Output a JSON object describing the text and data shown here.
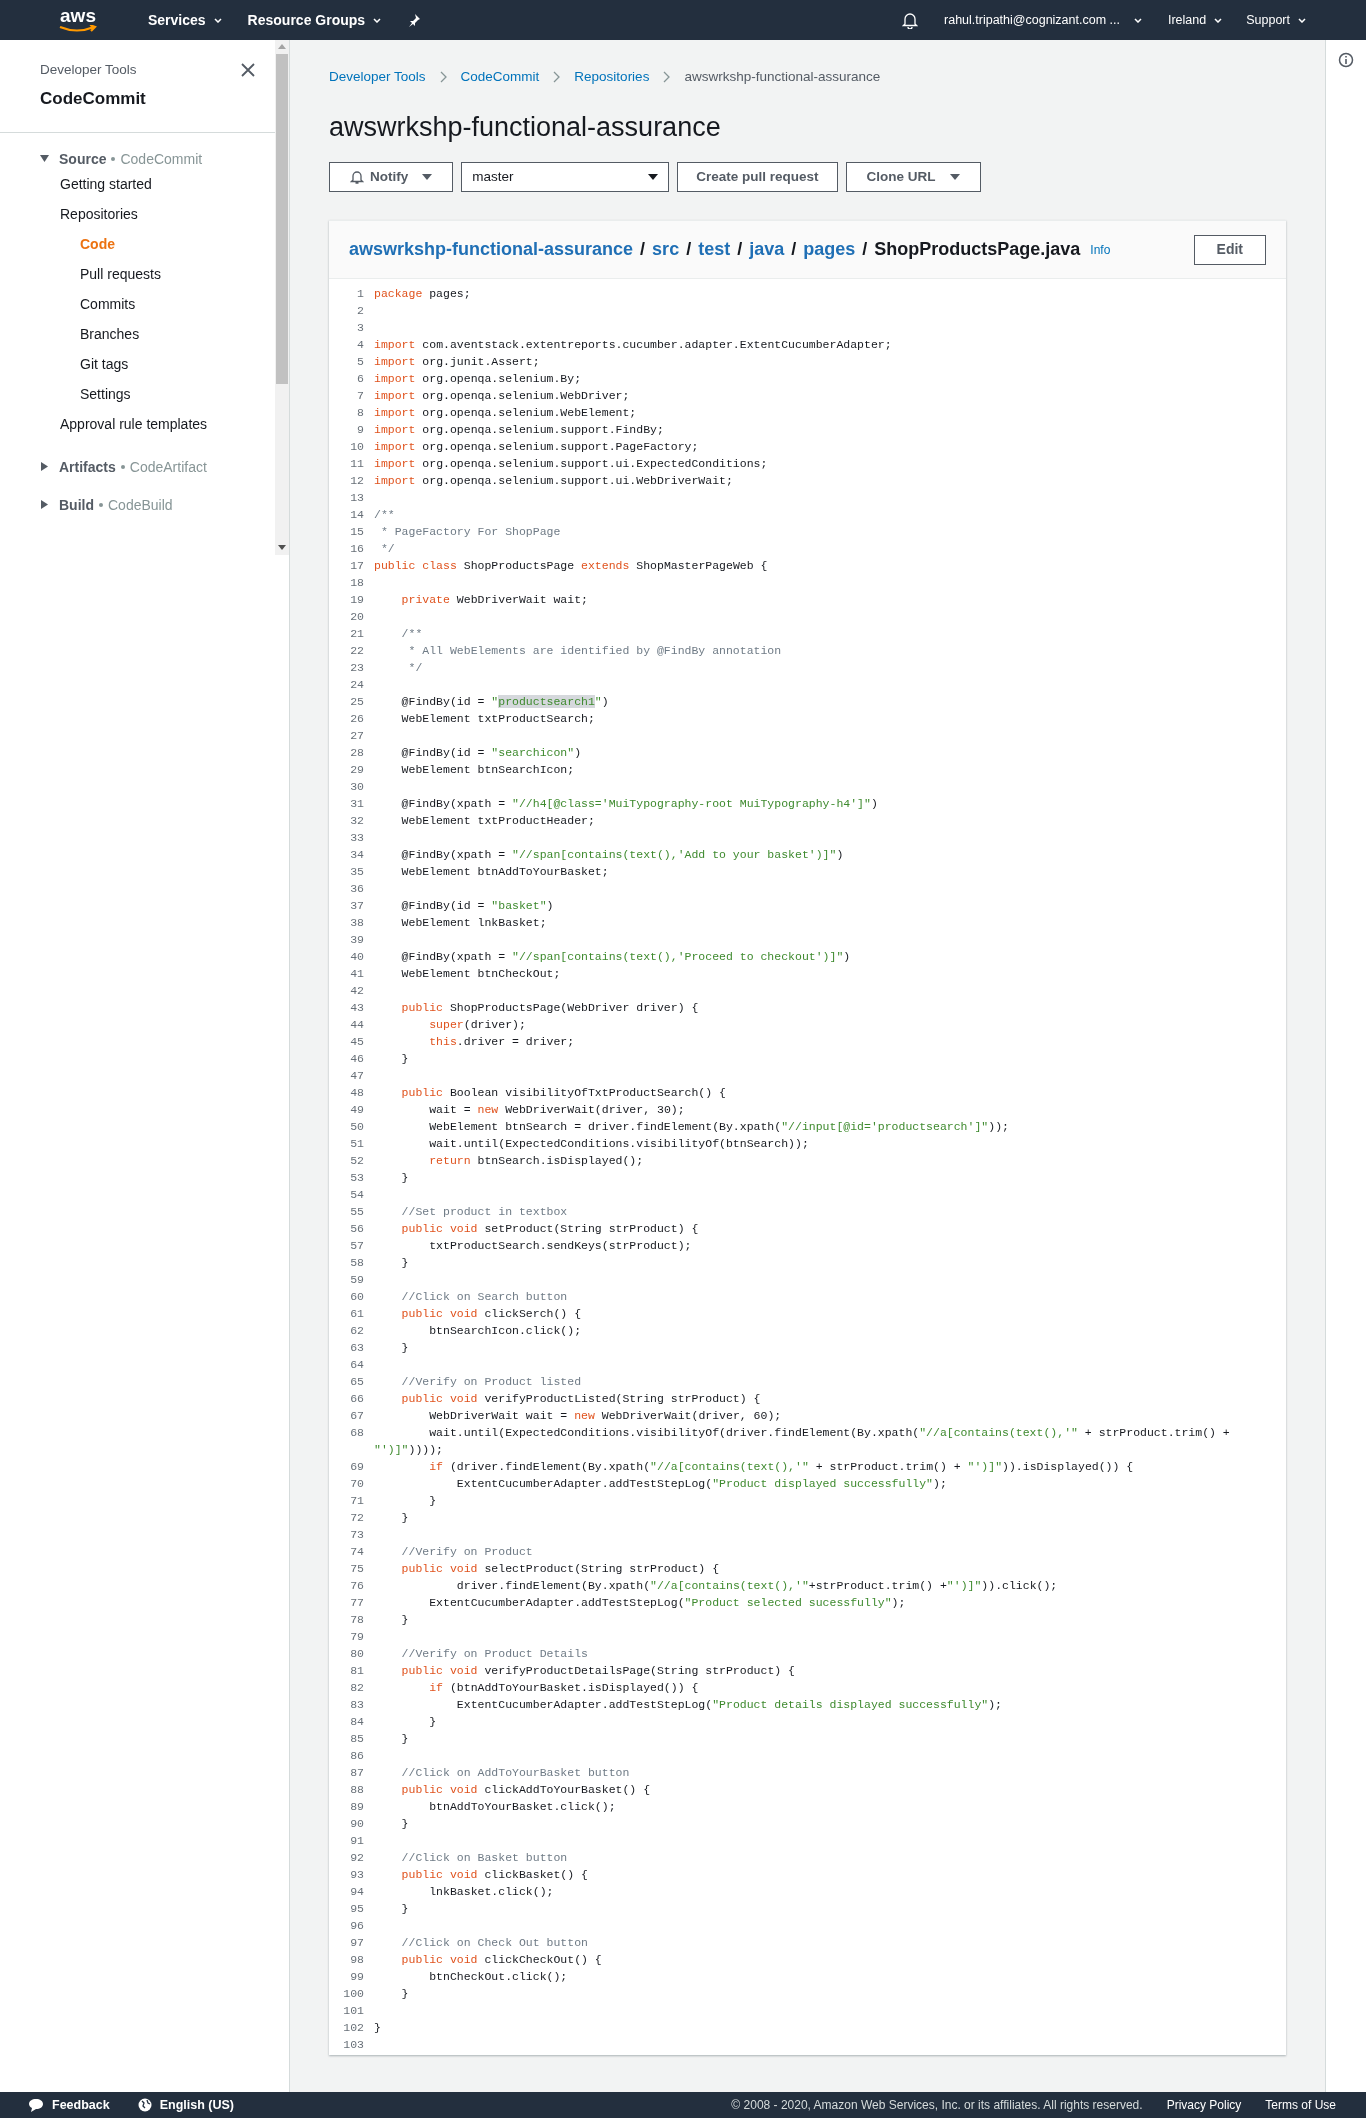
{
  "topnav": {
    "logo": "aws",
    "menus": [
      {
        "label": "Services"
      },
      {
        "label": "Resource Groups"
      }
    ],
    "account": "rahul.tripathi@cognizant.com ...",
    "region": "Ireland",
    "support": "Support"
  },
  "sidebar": {
    "subtitle": "Developer Tools",
    "title": "CodeCommit",
    "sections": [
      {
        "label": "Source",
        "service": "CodeCommit",
        "expanded": true,
        "children": [
          {
            "label": "Getting started",
            "selected": false
          },
          {
            "label": "Repositories",
            "selected": false,
            "children": [
              {
                "label": "Code",
                "selected": true
              },
              {
                "label": "Pull requests",
                "selected": false
              },
              {
                "label": "Commits",
                "selected": false
              },
              {
                "label": "Branches",
                "selected": false
              },
              {
                "label": "Git tags",
                "selected": false
              },
              {
                "label": "Settings",
                "selected": false
              }
            ]
          },
          {
            "label": "Approval rule templates",
            "selected": false
          }
        ]
      },
      {
        "label": "Artifacts",
        "service": "CodeArtifact",
        "expanded": false
      },
      {
        "label": "Build",
        "service": "CodeBuild",
        "expanded": false
      }
    ]
  },
  "breadcrumbs": [
    "Developer Tools",
    "CodeCommit",
    "Repositories",
    "awswrkshp-functional-assurance"
  ],
  "title": "awswrkshp-functional-assurance",
  "toolbar": {
    "notify": "Notify",
    "branch": "master",
    "create_pr": "Create pull request",
    "clone_url": "Clone URL"
  },
  "file": {
    "path": [
      "awswrkshp-functional-assurance",
      "src",
      "test",
      "java",
      "pages"
    ],
    "separator": "/",
    "name": "ShopProductsPage.java",
    "info": "Info",
    "edit": "Edit"
  },
  "code": [
    {
      "n": "1",
      "s": [
        {
          "kind": "keyword",
          "text": "package"
        },
        {
          "kind": "plain",
          "text": " pages;"
        }
      ]
    },
    {
      "n": "2"
    },
    {
      "n": "3"
    },
    {
      "n": "4",
      "s": [
        {
          "kind": "keyword",
          "text": "import"
        },
        {
          "kind": "plain",
          "text": " com.aventstack.extentreports.cucumber.adapter.ExtentCucumberAdapter;"
        }
      ]
    },
    {
      "n": "5",
      "s": [
        {
          "kind": "keyword",
          "text": "import"
        },
        {
          "kind": "plain",
          "text": " org.junit.Assert;"
        }
      ]
    },
    {
      "n": "6",
      "s": [
        {
          "kind": "keyword",
          "text": "import"
        },
        {
          "kind": "plain",
          "text": " org.openqa.selenium.By;"
        }
      ]
    },
    {
      "n": "7",
      "s": [
        {
          "kind": "keyword",
          "text": "import"
        },
        {
          "kind": "plain",
          "text": " org.openqa.selenium.WebDriver;"
        }
      ]
    },
    {
      "n": "8",
      "s": [
        {
          "kind": "keyword",
          "text": "import"
        },
        {
          "kind": "plain",
          "text": " org.openqa.selenium.WebElement;"
        }
      ]
    },
    {
      "n": "9",
      "s": [
        {
          "kind": "keyword",
          "text": "import"
        },
        {
          "kind": "plain",
          "text": " org.openqa.selenium.support.FindBy;"
        }
      ]
    },
    {
      "n": "10",
      "s": [
        {
          "kind": "keyword",
          "text": "import"
        },
        {
          "kind": "plain",
          "text": " org.openqa.selenium.support.PageFactory;"
        }
      ]
    },
    {
      "n": "11",
      "s": [
        {
          "kind": "keyword",
          "text": "import"
        },
        {
          "kind": "plain",
          "text": " org.openqa.selenium.support.ui.ExpectedConditions;"
        }
      ]
    },
    {
      "n": "12",
      "s": [
        {
          "kind": "keyword",
          "text": "import"
        },
        {
          "kind": "plain",
          "text": " org.openqa.selenium.support.ui.WebDriverWait;"
        }
      ]
    },
    {
      "n": "13"
    },
    {
      "n": "14",
      "s": [
        {
          "kind": "comment",
          "text": "/**"
        }
      ]
    },
    {
      "n": "15",
      "s": [
        {
          "kind": "comment",
          "text": " * PageFactory For ShopPage"
        }
      ]
    },
    {
      "n": "16",
      "s": [
        {
          "kind": "comment",
          "text": " */"
        }
      ]
    },
    {
      "n": "17",
      "s": [
        {
          "kind": "keyword",
          "text": "public class"
        },
        {
          "kind": "plain",
          "text": " ShopProductsPage "
        },
        {
          "kind": "keyword",
          "text": "extends"
        },
        {
          "kind": "plain",
          "text": " ShopMasterPageWeb {"
        }
      ]
    },
    {
      "n": "18"
    },
    {
      "n": "19",
      "s": [
        {
          "kind": "keyword",
          "text": "    private"
        },
        {
          "kind": "plain",
          "text": " WebDriverWait wait;"
        }
      ]
    },
    {
      "n": "20"
    },
    {
      "n": "21",
      "s": [
        {
          "kind": "comment",
          "text": "    /**"
        }
      ]
    },
    {
      "n": "22",
      "s": [
        {
          "kind": "comment",
          "text": "     * All WebElements are identified by @FindBy annotation"
        }
      ]
    },
    {
      "n": "23",
      "s": [
        {
          "kind": "comment",
          "text": "     */"
        }
      ]
    },
    {
      "n": "24"
    },
    {
      "n": "25",
      "s": [
        {
          "kind": "plain",
          "text": "    @FindBy(id = "
        },
        {
          "kind": "string",
          "text": "\""
        },
        {
          "kind": "highlight",
          "text": "productsearch1"
        },
        {
          "kind": "string",
          "text": "\""
        },
        {
          "kind": "plain",
          "text": ")"
        }
      ]
    },
    {
      "n": "26",
      "s": [
        {
          "kind": "plain",
          "text": "    WebElement txtProductSearch;"
        }
      ]
    },
    {
      "n": "27"
    },
    {
      "n": "28",
      "s": [
        {
          "kind": "plain",
          "text": "    @FindBy(id = "
        },
        {
          "kind": "string",
          "text": "\"searchicon\""
        },
        {
          "kind": "plain",
          "text": ")"
        }
      ]
    },
    {
      "n": "29",
      "s": [
        {
          "kind": "plain",
          "text": "    WebElement btnSearchIcon;"
        }
      ]
    },
    {
      "n": "30"
    },
    {
      "n": "31",
      "s": [
        {
          "kind": "plain",
          "text": "    @FindBy(xpath = "
        },
        {
          "kind": "string",
          "text": "\"//h4[@class='MuiTypography-root MuiTypography-h4']\""
        },
        {
          "kind": "plain",
          "text": ")"
        }
      ]
    },
    {
      "n": "32",
      "s": [
        {
          "kind": "plain",
          "text": "    WebElement txtProductHeader;"
        }
      ]
    },
    {
      "n": "33"
    },
    {
      "n": "34",
      "s": [
        {
          "kind": "plain",
          "text": "    @FindBy(xpath = "
        },
        {
          "kind": "string",
          "text": "\"//span[contains(text(),'Add to your basket')]\""
        },
        {
          "kind": "plain",
          "text": ")"
        }
      ]
    },
    {
      "n": "35",
      "s": [
        {
          "kind": "plain",
          "text": "    WebElement btnAddToYourBasket;"
        }
      ]
    },
    {
      "n": "36"
    },
    {
      "n": "37",
      "s": [
        {
          "kind": "plain",
          "text": "    @FindBy(id = "
        },
        {
          "kind": "string",
          "text": "\"basket\""
        },
        {
          "kind": "plain",
          "text": ")"
        }
      ]
    },
    {
      "n": "38",
      "s": [
        {
          "kind": "plain",
          "text": "    WebElement lnkBasket;"
        }
      ]
    },
    {
      "n": "39"
    },
    {
      "n": "40",
      "s": [
        {
          "kind": "plain",
          "text": "    @FindBy(xpath = "
        },
        {
          "kind": "string",
          "text": "\"//span[contains(text(),'Proceed to checkout')]\""
        },
        {
          "kind": "plain",
          "text": ")"
        }
      ]
    },
    {
      "n": "41",
      "s": [
        {
          "kind": "plain",
          "text": "    WebElement btnCheckOut;"
        }
      ]
    },
    {
      "n": "42"
    },
    {
      "n": "43",
      "s": [
        {
          "kind": "keyword",
          "text": "    public"
        },
        {
          "kind": "plain",
          "text": " ShopProductsPage(WebDriver driver) {"
        }
      ]
    },
    {
      "n": "44",
      "s": [
        {
          "kind": "keyword",
          "text": "        super"
        },
        {
          "kind": "plain",
          "text": "(driver);"
        }
      ]
    },
    {
      "n": "45",
      "s": [
        {
          "kind": "keyword",
          "text": "        this"
        },
        {
          "kind": "plain",
          "text": ".driver = driver;"
        }
      ]
    },
    {
      "n": "46",
      "s": [
        {
          "kind": "plain",
          "text": "    }"
        }
      ]
    },
    {
      "n": "47"
    },
    {
      "n": "48",
      "s": [
        {
          "kind": "keyword",
          "text": "    public"
        },
        {
          "kind": "plain",
          "text": " Boolean visibilityOfTxtProductSearch() {"
        }
      ]
    },
    {
      "n": "49",
      "s": [
        {
          "kind": "plain",
          "text": "        wait = "
        },
        {
          "kind": "keyword",
          "text": "new"
        },
        {
          "kind": "plain",
          "text": " WebDriverWait(driver, 30);"
        }
      ]
    },
    {
      "n": "50",
      "s": [
        {
          "kind": "plain",
          "text": "        WebElement btnSearch = driver.findElement(By.xpath("
        },
        {
          "kind": "string",
          "text": "\"//input[@id='productsearch']\""
        },
        {
          "kind": "plain",
          "text": "));"
        }
      ]
    },
    {
      "n": "51",
      "s": [
        {
          "kind": "plain",
          "text": "        wait.until(ExpectedConditions.visibilityOf(btnSearch));"
        }
      ]
    },
    {
      "n": "52",
      "s": [
        {
          "kind": "keyword",
          "text": "        return"
        },
        {
          "kind": "plain",
          "text": " btnSearch.isDisplayed();"
        }
      ]
    },
    {
      "n": "53",
      "s": [
        {
          "kind": "plain",
          "text": "    }"
        }
      ]
    },
    {
      "n": "54"
    },
    {
      "n": "55",
      "s": [
        {
          "kind": "comment",
          "text": "    //Set product in textbox"
        }
      ]
    },
    {
      "n": "56",
      "s": [
        {
          "kind": "keyword",
          "text": "    public void"
        },
        {
          "kind": "plain",
          "text": " setProduct(String strProduct) {"
        }
      ]
    },
    {
      "n": "57",
      "s": [
        {
          "kind": "plain",
          "text": "        txtProductSearch.sendKeys(strProduct);"
        }
      ]
    },
    {
      "n": "58",
      "s": [
        {
          "kind": "plain",
          "text": "    }"
        }
      ]
    },
    {
      "n": "59"
    },
    {
      "n": "60",
      "s": [
        {
          "kind": "comment",
          "text": "    //Click on Search button"
        }
      ]
    },
    {
      "n": "61",
      "s": [
        {
          "kind": "keyword",
          "text": "    public void"
        },
        {
          "kind": "plain",
          "text": " clickSerch() {"
        }
      ]
    },
    {
      "n": "62",
      "s": [
        {
          "kind": "plain",
          "text": "        btnSearchIcon.click();"
        }
      ]
    },
    {
      "n": "63",
      "s": [
        {
          "kind": "plain",
          "text": "    }"
        }
      ]
    },
    {
      "n": "64"
    },
    {
      "n": "65",
      "s": [
        {
          "kind": "comment",
          "text": "    //Verify on Product listed"
        }
      ]
    },
    {
      "n": "66",
      "s": [
        {
          "kind": "keyword",
          "text": "    public void"
        },
        {
          "kind": "plain",
          "text": " verifyProductListed(String strProduct) {"
        }
      ]
    },
    {
      "n": "67",
      "s": [
        {
          "kind": "plain",
          "text": "        WebDriverWait wait = "
        },
        {
          "kind": "keyword",
          "text": "new"
        },
        {
          "kind": "plain",
          "text": " WebDriverWait(driver, 60);"
        }
      ]
    },
    {
      "n": "68",
      "s": [
        {
          "kind": "plain",
          "text": "        wait.until(ExpectedConditions.visibilityOf(driver.findElement(By.xpath("
        },
        {
          "kind": "string",
          "text": "\"//a[contains(text(),'\""
        },
        {
          "kind": "plain",
          "text": " + strProduct.trim() + "
        },
        {
          "kind": "string",
          "text": "\"')]\""
        },
        {
          "kind": "plain",
          "text": "))));"
        }
      ]
    },
    {
      "n": "69",
      "s": [
        {
          "kind": "keyword",
          "text": "        if"
        },
        {
          "kind": "plain",
          "text": " (driver.findElement(By.xpath("
        },
        {
          "kind": "string",
          "text": "\"//a[contains(text(),'\""
        },
        {
          "kind": "plain",
          "text": " + strProduct.trim() + "
        },
        {
          "kind": "string",
          "text": "\"')]\""
        },
        {
          "kind": "plain",
          "text": ")).isDisplayed()) {"
        }
      ]
    },
    {
      "n": "70",
      "s": [
        {
          "kind": "plain",
          "text": "            ExtentCucumberAdapter.addTestStepLog("
        },
        {
          "kind": "string",
          "text": "\"Product displayed successfully\""
        },
        {
          "kind": "plain",
          "text": ");"
        }
      ]
    },
    {
      "n": "71",
      "s": [
        {
          "kind": "plain",
          "text": "        }"
        }
      ]
    },
    {
      "n": "72",
      "s": [
        {
          "kind": "plain",
          "text": "    }"
        }
      ]
    },
    {
      "n": "73"
    },
    {
      "n": "74",
      "s": [
        {
          "kind": "comment",
          "text": "    //Verify on Product"
        }
      ]
    },
    {
      "n": "75",
      "s": [
        {
          "kind": "keyword",
          "text": "    public void"
        },
        {
          "kind": "plain",
          "text": " selectProduct(String strProduct) {"
        }
      ]
    },
    {
      "n": "76",
      "s": [
        {
          "kind": "plain",
          "text": "            driver.findElement(By.xpath("
        },
        {
          "kind": "string",
          "text": "\"//a[contains(text(),'\""
        },
        {
          "kind": "plain",
          "text": "+strProduct.trim() +"
        },
        {
          "kind": "string",
          "text": "\"')]\""
        },
        {
          "kind": "plain",
          "text": ")).click();"
        }
      ]
    },
    {
      "n": "77",
      "s": [
        {
          "kind": "plain",
          "text": "        ExtentCucumberAdapter.addTestStepLog("
        },
        {
          "kind": "string",
          "text": "\"Product selected sucessfully\""
        },
        {
          "kind": "plain",
          "text": ");"
        }
      ]
    },
    {
      "n": "78",
      "s": [
        {
          "kind": "plain",
          "text": "    }"
        }
      ]
    },
    {
      "n": "79"
    },
    {
      "n": "80",
      "s": [
        {
          "kind": "comment",
          "text": "    //Verify on Product Details"
        }
      ]
    },
    {
      "n": "81",
      "s": [
        {
          "kind": "keyword",
          "text": "    public void"
        },
        {
          "kind": "plain",
          "text": " verifyProductDetailsPage(String strProduct) {"
        }
      ]
    },
    {
      "n": "82",
      "s": [
        {
          "kind": "keyword",
          "text": "        if"
        },
        {
          "kind": "plain",
          "text": " (btnAddToYourBasket.isDisplayed()) {"
        }
      ]
    },
    {
      "n": "83",
      "s": [
        {
          "kind": "plain",
          "text": "            ExtentCucumberAdapter.addTestStepLog("
        },
        {
          "kind": "string",
          "text": "\"Product details displayed successfully\""
        },
        {
          "kind": "plain",
          "text": ");"
        }
      ]
    },
    {
      "n": "84",
      "s": [
        {
          "kind": "plain",
          "text": "        }"
        }
      ]
    },
    {
      "n": "85",
      "s": [
        {
          "kind": "plain",
          "text": "    }"
        }
      ]
    },
    {
      "n": "86"
    },
    {
      "n": "87",
      "s": [
        {
          "kind": "comment",
          "text": "    //Click on AddToYourBasket button"
        }
      ]
    },
    {
      "n": "88",
      "s": [
        {
          "kind": "keyword",
          "text": "    public void"
        },
        {
          "kind": "plain",
          "text": " clickAddToYourBasket() {"
        }
      ]
    },
    {
      "n": "89",
      "s": [
        {
          "kind": "plain",
          "text": "        btnAddToYourBasket.click();"
        }
      ]
    },
    {
      "n": "90",
      "s": [
        {
          "kind": "plain",
          "text": "    }"
        }
      ]
    },
    {
      "n": "91"
    },
    {
      "n": "92",
      "s": [
        {
          "kind": "comment",
          "text": "    //Click on Basket button"
        }
      ]
    },
    {
      "n": "93",
      "s": [
        {
          "kind": "keyword",
          "text": "    public void"
        },
        {
          "kind": "plain",
          "text": " clickBasket() {"
        }
      ]
    },
    {
      "n": "94",
      "s": [
        {
          "kind": "plain",
          "text": "        lnkBasket.click();"
        }
      ]
    },
    {
      "n": "95",
      "s": [
        {
          "kind": "plain",
          "text": "    }"
        }
      ]
    },
    {
      "n": "96"
    },
    {
      "n": "97",
      "s": [
        {
          "kind": "comment",
          "text": "    //Click on Check Out button"
        }
      ]
    },
    {
      "n": "98",
      "s": [
        {
          "kind": "keyword",
          "text": "    public void"
        },
        {
          "kind": "plain",
          "text": " clickCheckOut() {"
        }
      ]
    },
    {
      "n": "99",
      "s": [
        {
          "kind": "plain",
          "text": "        btnCheckOut.click();"
        }
      ]
    },
    {
      "n": "100",
      "s": [
        {
          "kind": "plain",
          "text": "    }"
        }
      ]
    },
    {
      "n": "101"
    },
    {
      "n": "102",
      "s": [
        {
          "kind": "plain",
          "text": "}"
        }
      ]
    },
    {
      "n": "103"
    }
  ],
  "footer": {
    "feedback": "Feedback",
    "language": "English (US)",
    "copyright": "© 2008 - 2020, Amazon Web Services, Inc. or its affiliates. All rights reserved.",
    "links": [
      "Privacy Policy",
      "Terms of Use"
    ]
  }
}
